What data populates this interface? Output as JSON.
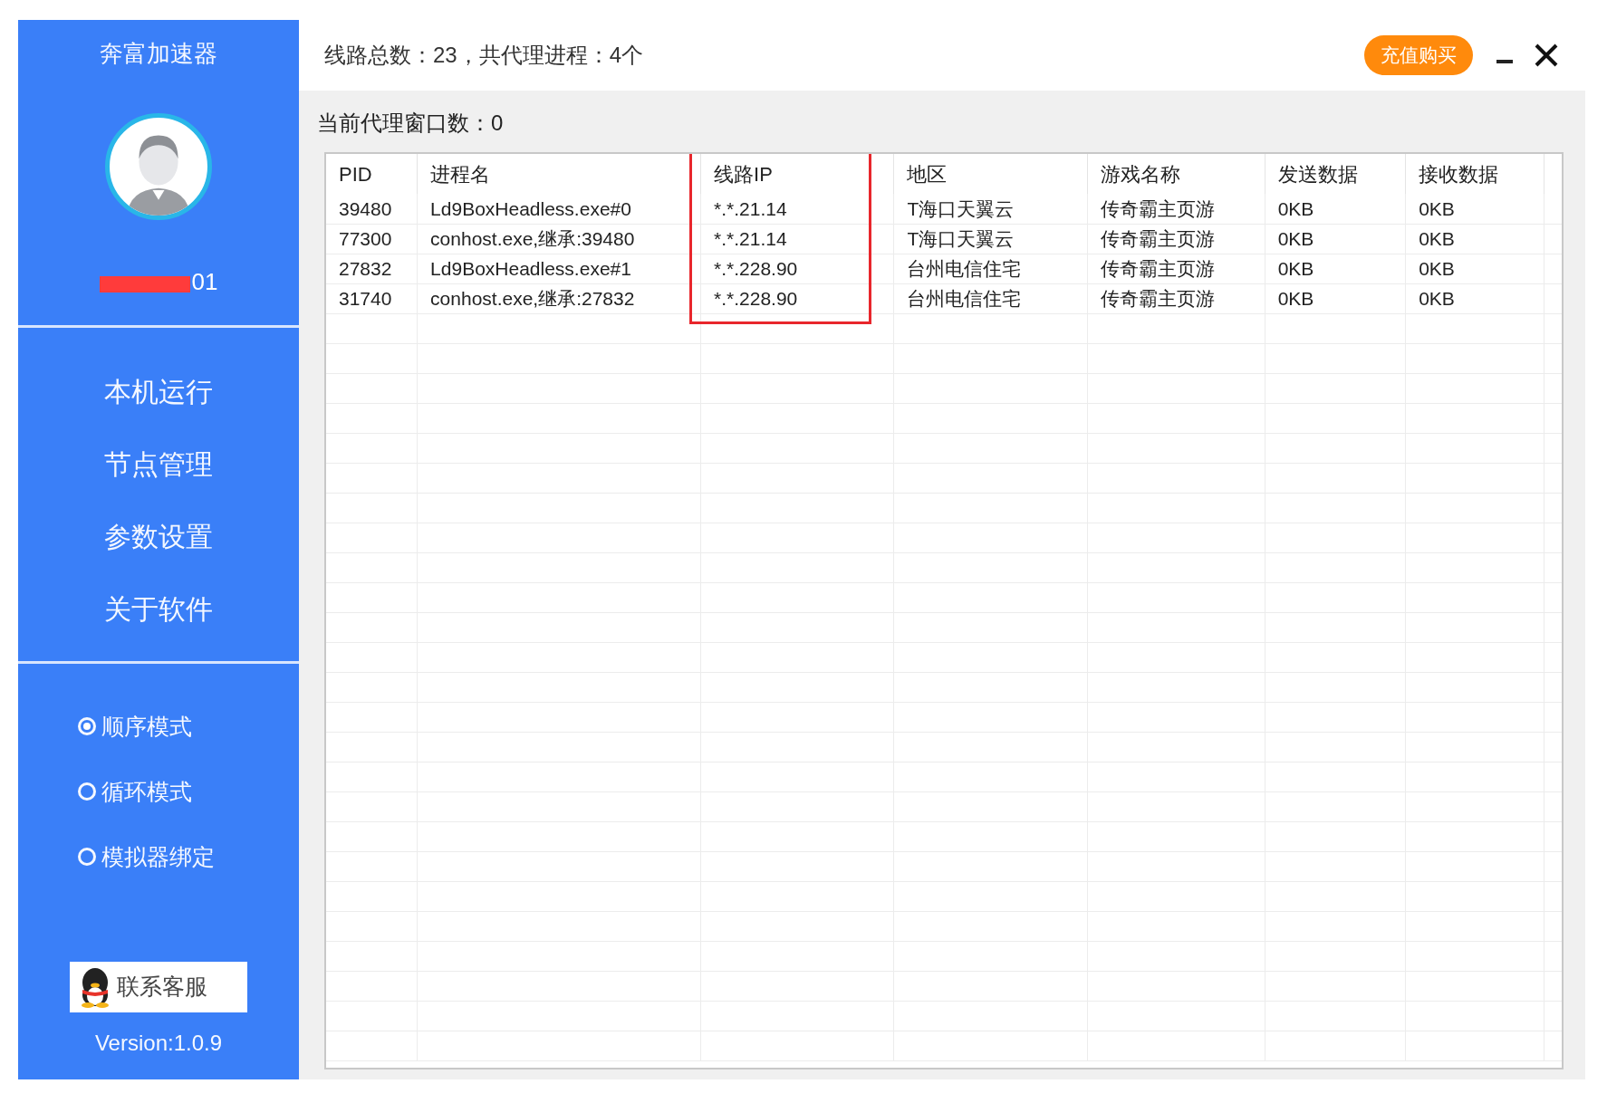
{
  "sidebar": {
    "app_title": "奔富加速器",
    "username": "01",
    "nav": [
      "本机运行",
      "节点管理",
      "参数设置",
      "关于软件"
    ],
    "modes": [
      {
        "label": "顺序模式",
        "selected": true
      },
      {
        "label": "循环模式",
        "selected": false
      },
      {
        "label": "模拟器绑定",
        "selected": false
      }
    ],
    "contact_button": "联系客服",
    "version": "Version:1.0.9"
  },
  "header": {
    "summary": "线路总数：23，共代理进程：4个",
    "buy_button": "充值购买"
  },
  "window_count": "当前代理窗口数：0",
  "table": {
    "columns": [
      {
        "label": "PID",
        "highlighted": false
      },
      {
        "label": "进程名",
        "highlighted": false
      },
      {
        "label": "线路IP",
        "highlighted": true
      },
      {
        "label": "地区",
        "highlighted": false
      },
      {
        "label": "游戏名称",
        "highlighted": false
      },
      {
        "label": "发送数据",
        "highlighted": false
      },
      {
        "label": "接收数据",
        "highlighted": false
      }
    ],
    "rows": [
      [
        "39480",
        "Ld9BoxHeadless.exe#0",
        "*.*.21.14",
        "T海口天翼云",
        "传奇霸主页游",
        "0KB",
        "0KB"
      ],
      [
        "77300",
        "conhost.exe,继承:39480",
        "*.*.21.14",
        "T海口天翼云",
        "传奇霸主页游",
        "0KB",
        "0KB"
      ],
      [
        "27832",
        "Ld9BoxHeadless.exe#1",
        "*.*.228.90",
        "台州电信住宅",
        "传奇霸主页游",
        "0KB",
        "0KB"
      ],
      [
        "31740",
        "conhost.exe,继承:27832",
        "*.*.228.90",
        "台州电信住宅",
        "传奇霸主页游",
        "0KB",
        "0KB"
      ]
    ]
  }
}
